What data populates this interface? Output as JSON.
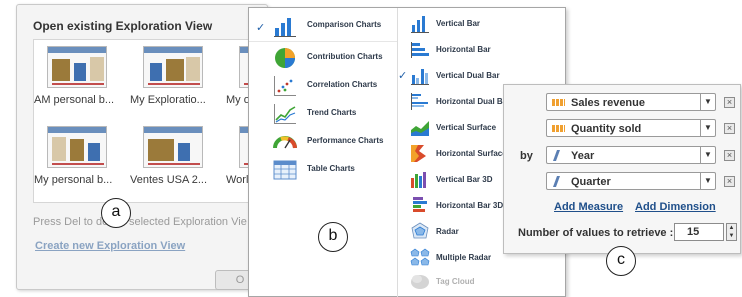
{
  "panel_a": {
    "title": "Open existing Exploration View",
    "tiles": [
      {
        "caption": "AM personal b..."
      },
      {
        "caption": "My Exploratio..."
      },
      {
        "caption": "My ov"
      },
      {
        "caption": "My personal b..."
      },
      {
        "caption": "Ventes USA 2..."
      },
      {
        "caption": "Worlc"
      }
    ],
    "hint": "Press Del to delete selected Exploration Vie",
    "create_link": "Create new Exploration View",
    "ok_label": "O"
  },
  "panel_b": {
    "categories": [
      {
        "label": "Comparison Charts",
        "checked": true,
        "icon": "comparison-chart-icon"
      },
      {
        "label": "Contribution Charts",
        "checked": false,
        "icon": "pie-chart-icon"
      },
      {
        "label": "Correlation Charts",
        "checked": false,
        "icon": "scatter-chart-icon"
      },
      {
        "label": "Trend Charts",
        "checked": false,
        "icon": "trend-chart-icon"
      },
      {
        "label": "Performance Charts",
        "checked": false,
        "icon": "gauge-chart-icon"
      },
      {
        "label": "Table Charts",
        "checked": false,
        "icon": "table-chart-icon"
      }
    ],
    "chart_types": [
      {
        "label": "Vertical Bar",
        "checked": false,
        "disabled": false,
        "icon": "vertical-bar-icon"
      },
      {
        "label": "Horizontal Bar",
        "checked": false,
        "disabled": false,
        "icon": "horizontal-bar-icon"
      },
      {
        "label": "Vertical Dual Bar",
        "checked": true,
        "disabled": false,
        "icon": "vertical-dual-bar-icon"
      },
      {
        "label": "Horizontal Dual Bar",
        "checked": false,
        "disabled": false,
        "icon": "horizontal-dual-bar-icon"
      },
      {
        "label": "Vertical Surface",
        "checked": false,
        "disabled": false,
        "icon": "vertical-surface-icon"
      },
      {
        "label": "Horizontal Surface",
        "checked": false,
        "disabled": false,
        "icon": "horizontal-surface-icon"
      },
      {
        "label": "Vertical Bar 3D",
        "checked": false,
        "disabled": false,
        "icon": "vertical-bar-3d-icon"
      },
      {
        "label": "Horizontal Bar 3D",
        "checked": false,
        "disabled": false,
        "icon": "horizontal-bar-3d-icon"
      },
      {
        "label": "Radar",
        "checked": false,
        "disabled": false,
        "icon": "radar-icon"
      },
      {
        "label": "Multiple Radar",
        "checked": false,
        "disabled": false,
        "icon": "multiple-radar-icon"
      },
      {
        "label": "Tag Cloud",
        "checked": false,
        "disabled": true,
        "icon": "tag-cloud-icon"
      }
    ],
    "check_mark": "✓"
  },
  "panel_c": {
    "measures": [
      "Sales revenue",
      "Quantity sold"
    ],
    "by_label": "by",
    "dimensions": [
      "Year",
      "Quarter"
    ],
    "dropdown_arrow": "▼",
    "remove_glyph": "×",
    "add_measure": "Add Measure",
    "add_dimension": "Add Dimension",
    "num_values_label": "Number of values to retrieve :",
    "num_values": "15",
    "spin_up": "▲",
    "spin_down": "▼"
  },
  "callouts": {
    "a": "a",
    "b": "b",
    "c": "c"
  }
}
